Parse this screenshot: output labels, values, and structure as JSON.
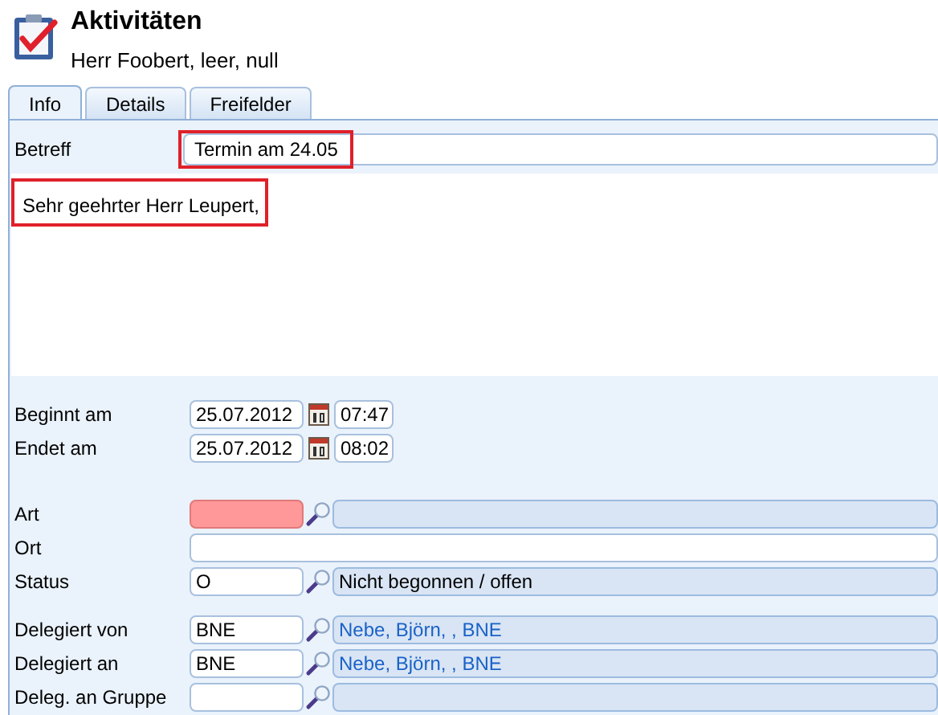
{
  "header": {
    "title": "Aktivitäten",
    "subtitle": "Herr Foobert, leer, null"
  },
  "tabs": [
    {
      "label": "Info",
      "selected": true
    },
    {
      "label": "Details",
      "selected": false
    },
    {
      "label": "Freifelder",
      "selected": false
    }
  ],
  "subject": {
    "label": "Betreff",
    "value": "Termin am 24.05",
    "highlighted": true
  },
  "body": {
    "text": "Sehr geehrter Herr Leupert,",
    "highlighted": true
  },
  "groups": [
    [
      {
        "kind": "date",
        "label": "Beginnt am",
        "date": "25.07.2012",
        "time": "07:47"
      },
      {
        "kind": "date",
        "label": "Endet am",
        "date": "25.07.2012",
        "time": "08:02"
      }
    ],
    [
      {
        "kind": "lookup",
        "label": "Art",
        "invalid": true
      },
      {
        "kind": "text",
        "label": "Ort"
      },
      {
        "kind": "lookup",
        "label": "Status",
        "code": "O",
        "description": "Nicht begonnen / offen",
        "invalid": false,
        "linked": false
      }
    ],
    [
      {
        "kind": "lookup",
        "label": "Delegiert von",
        "code": "BNE",
        "description": "Nebe, Björn, , BNE",
        "invalid": false,
        "linked": true
      },
      {
        "kind": "lookup",
        "label": "Delegiert an",
        "code": "BNE",
        "description": "Nebe, Björn, , BNE",
        "invalid": false,
        "linked": true
      },
      {
        "kind": "lookup",
        "label": "Deleg. an Gruppe",
        "invalid": false
      }
    ]
  ]
}
